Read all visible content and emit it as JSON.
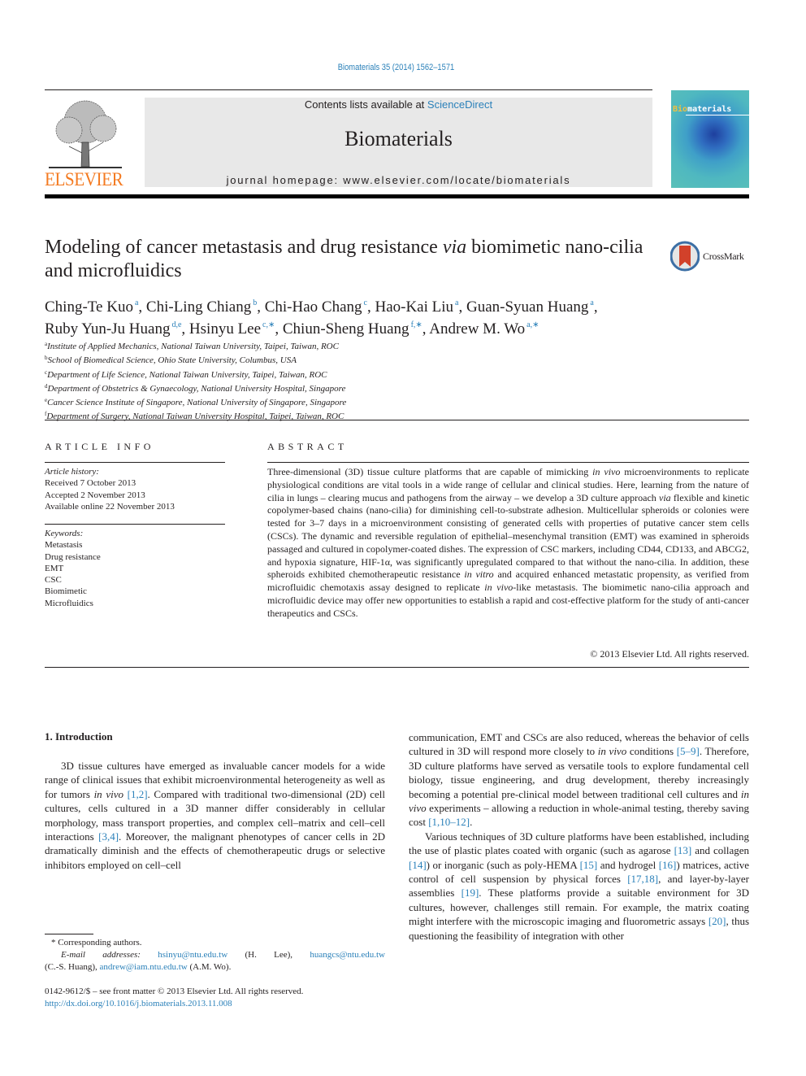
{
  "header": {
    "journal_reference": "Biomaterials 35 (2014) 1562–1571",
    "publisher_logo_text": "ELSEVIER",
    "contents_prefix": "Contents lists available at ",
    "contents_link": "ScienceDirect",
    "journal_name": "Biomaterials",
    "homepage_line": "journal homepage: www.elsevier.com/locate/biomaterials",
    "cover_title_highlight": "Bio",
    "cover_title_rest": "materials",
    "colors": {
      "accent_link": "#2a80b9",
      "elsevier_orange": "#f47a20",
      "masthead_gray": "#e8e8e8"
    }
  },
  "article": {
    "title_part1": "Modeling of cancer metastasis and drug resistance ",
    "title_italic": "via",
    "title_part2": " biomimetic nano-cilia and microfluidics",
    "crossmark_label": "CrossMark",
    "authors": [
      {
        "name": "Ching-Te Kuo",
        "sup": "a",
        "sep": ", "
      },
      {
        "name": "Chi-Ling Chiang",
        "sup": "b",
        "sep": ", "
      },
      {
        "name": "Chi-Hao Chang",
        "sup": "c",
        "sep": ", "
      },
      {
        "name": "Hao-Kai Liu",
        "sup": "a",
        "sep": ", "
      },
      {
        "name": "Guan-Syuan Huang",
        "sup": "a",
        "sep": ","
      },
      {
        "name": "Ruby Yun-Ju Huang",
        "sup": "d,e",
        "sep": ", "
      },
      {
        "name": "Hsinyu Lee",
        "sup": "c,∗",
        "sep": ", "
      },
      {
        "name": "Chiun-Sheng Huang",
        "sup": "f,∗",
        "sep": ", "
      },
      {
        "name": "Andrew M. Wo",
        "sup": "a,∗",
        "sep": ""
      }
    ],
    "affiliations": [
      {
        "key": "a",
        "text": "Institute of Applied Mechanics, National Taiwan University, Taipei, Taiwan, ROC"
      },
      {
        "key": "b",
        "text": "School of Biomedical Science, Ohio State University, Columbus, USA"
      },
      {
        "key": "c",
        "text": "Department of Life Science, National Taiwan University, Taipei, Taiwan, ROC"
      },
      {
        "key": "d",
        "text": "Department of Obstetrics & Gynaecology, National University Hospital, Singapore"
      },
      {
        "key": "e",
        "text": "Cancer Science Institute of Singapore, National University of Singapore, Singapore"
      },
      {
        "key": "f",
        "text": "Department of Surgery, National Taiwan University Hospital, Taipei, Taiwan, ROC"
      }
    ]
  },
  "article_info": {
    "heading": "ARTICLE INFO",
    "history_label": "Article history:",
    "history": [
      "Received 7 October 2013",
      "Accepted 2 November 2013",
      "Available online 22 November 2013"
    ],
    "keywords_label": "Keywords:",
    "keywords": [
      "Metastasis",
      "Drug resistance",
      "EMT",
      "CSC",
      "Biomimetic",
      "Microfluidics"
    ]
  },
  "abstract": {
    "heading": "ABSTRACT",
    "segments": [
      {
        "t": "Three-dimensional (3D) tissue culture platforms that are capable of mimicking ",
        "i": false
      },
      {
        "t": "in vivo",
        "i": true
      },
      {
        "t": " microenvironments to replicate physiological conditions are vital tools in a wide range of cellular and clinical studies. Here, learning from the nature of cilia in lungs – clearing mucus and pathogens from the airway – we develop a 3D culture approach ",
        "i": false
      },
      {
        "t": "via",
        "i": true
      },
      {
        "t": " flexible and kinetic copolymer-based chains (nano-cilia) for diminishing cell-to-substrate adhesion. Multicellular spheroids or colonies were tested for 3–7 days in a microenvironment consisting of generated cells with properties of putative cancer stem cells (CSCs). The dynamic and reversible regulation of epithelial–mesenchymal transition (EMT) was examined in spheroids passaged and cultured in copolymer-coated dishes. The expression of CSC markers, including CD44, CD133, and ABCG2, and hypoxia signature, HIF-1α, was significantly upregulated compared to that without the nano-cilia. In addition, these spheroids exhibited chemotherapeutic resistance ",
        "i": false
      },
      {
        "t": "in vitro",
        "i": true
      },
      {
        "t": " and acquired enhanced metastatic propensity, as verified from microfluidic chemotaxis assay designed to replicate ",
        "i": false
      },
      {
        "t": "in vivo",
        "i": true
      },
      {
        "t": "-like metastasis. The biomimetic nano-cilia approach and microfluidic device may offer new opportunities to establish a rapid and cost-effective platform for the study of anti-cancer therapeutics and CSCs.",
        "i": false
      }
    ],
    "copyright": "© 2013 Elsevier Ltd. All rights reserved."
  },
  "introduction": {
    "heading": "1.  Introduction",
    "left_column": [
      {
        "t": "3D tissue cultures have emerged as invaluable cancer models for a wide range of clinical issues that exhibit microenvironmental heterogeneity as well as for tumors ",
        "k": "text"
      },
      {
        "t": "in vivo",
        "k": "italic"
      },
      {
        "t": " ",
        "k": "text"
      },
      {
        "t": "[1,2]",
        "k": "cite"
      },
      {
        "t": ". Compared with traditional two-dimensional (2D) cell cultures, cells cultured in a 3D manner differ considerably in cellular morphology, mass transport properties, and complex cell–matrix and cell–cell interactions ",
        "k": "text"
      },
      {
        "t": "[3,4]",
        "k": "cite"
      },
      {
        "t": ". Moreover, the malignant phenotypes of cancer cells in 2D dramatically diminish and the effects of chemotherapeutic drugs or selective inhibitors employed on cell–cell",
        "k": "text"
      }
    ],
    "right_column_p1": [
      {
        "t": "communication, EMT and CSCs are also reduced, whereas the behavior of cells cultured in 3D will respond more closely to ",
        "k": "text"
      },
      {
        "t": "in vivo",
        "k": "italic"
      },
      {
        "t": " conditions ",
        "k": "text"
      },
      {
        "t": "[5–9]",
        "k": "cite"
      },
      {
        "t": ". Therefore, 3D culture platforms have served as versatile tools to explore fundamental cell biology, tissue engineering, and drug development, thereby increasingly becoming a potential pre-clinical model between traditional cell cultures and ",
        "k": "text"
      },
      {
        "t": "in vivo",
        "k": "italic"
      },
      {
        "t": " experiments – allowing a reduction in whole-animal testing, thereby saving cost ",
        "k": "text"
      },
      {
        "t": "[1,10–12]",
        "k": "cite"
      },
      {
        "t": ".",
        "k": "text"
      }
    ],
    "right_column_p2": [
      {
        "t": "Various techniques of 3D culture platforms have been established, including the use of plastic plates coated with organic (such as agarose ",
        "k": "text"
      },
      {
        "t": "[13]",
        "k": "cite"
      },
      {
        "t": " and collagen ",
        "k": "text"
      },
      {
        "t": "[14]",
        "k": "cite"
      },
      {
        "t": ") or inorganic (such as poly-HEMA ",
        "k": "text"
      },
      {
        "t": "[15]",
        "k": "cite"
      },
      {
        "t": " and hydrogel ",
        "k": "text"
      },
      {
        "t": "[16]",
        "k": "cite"
      },
      {
        "t": ") matrices, active control of cell suspension by physical forces ",
        "k": "text"
      },
      {
        "t": "[17,18]",
        "k": "cite"
      },
      {
        "t": ", and layer-by-layer assemblies ",
        "k": "text"
      },
      {
        "t": "[19]",
        "k": "cite"
      },
      {
        "t": ". These platforms provide a suitable environment for 3D cultures, however, challenges still remain. For example, the matrix coating might interfere with the microscopic imaging and fluorometric assays ",
        "k": "text"
      },
      {
        "t": "[20]",
        "k": "cite"
      },
      {
        "t": ", thus questioning the feasibility of integration with other",
        "k": "text"
      }
    ]
  },
  "footnotes": {
    "corresponding": "* Corresponding authors.",
    "email_label": "E-mail addresses:",
    "emails": [
      {
        "address": "hsinyu@ntu.edu.tw",
        "who": "(H. Lee),"
      },
      {
        "address": "huangcs@ntu.edu.tw",
        "who": "(C.-S. Huang),"
      },
      {
        "address": "andrew@iam.ntu.edu.tw",
        "who": "(A.M. Wo)."
      }
    ],
    "front_matter": "0142-9612/$ – see front matter © 2013 Elsevier Ltd. All rights reserved.",
    "doi_link": "http://dx.doi.org/10.1016/j.biomaterials.2013.11.008"
  }
}
